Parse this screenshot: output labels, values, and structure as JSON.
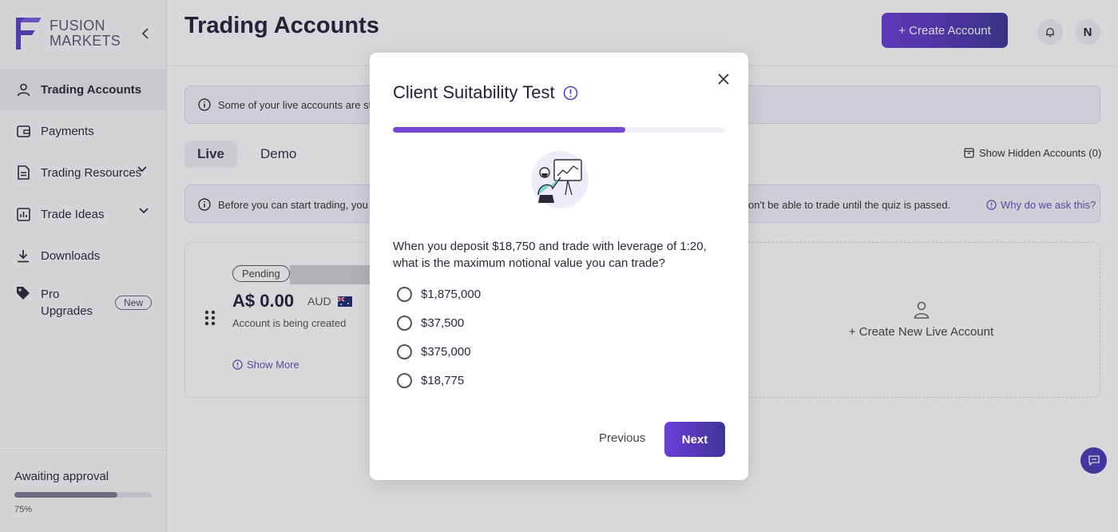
{
  "brand": {
    "line1": "FUSION",
    "line2": "MARKETS",
    "accent": "#6b3ed8"
  },
  "sidebar": {
    "items": [
      {
        "label": "Trading Accounts",
        "icon": "user-icon",
        "active": true
      },
      {
        "label": "Payments",
        "icon": "wallet-icon"
      },
      {
        "label": "Trading Resources",
        "icon": "document-icon"
      },
      {
        "label": "Trade Ideas",
        "icon": "chart-icon"
      },
      {
        "label": "Downloads",
        "icon": "download-icon"
      },
      {
        "label_line1": "Pro",
        "label_line2": "Upgrades",
        "icon": "tag-icon",
        "badge": "New"
      }
    ],
    "awaiting": {
      "label": "Awaiting approval",
      "progress_pct": 75,
      "progress_text": "75%"
    }
  },
  "header": {
    "title": "Trading Accounts",
    "create_label": "+ Create Account",
    "avatar_initial": "N"
  },
  "info_banner": {
    "text": "Some of your live accounts are still"
  },
  "tabs": [
    {
      "label": "Live",
      "active": true
    },
    {
      "label": "Demo"
    }
  ],
  "hidden_accounts_label": "Show Hidden Accounts (0)",
  "warn_banner": {
    "left_text": "Before you can start trading, you n",
    "right_text": "on't be able to trade until the quiz is passed.",
    "why_link": "Why do we ask this?"
  },
  "account": {
    "status_badge": "Pending",
    "balance": "A$ 0.00",
    "currency": "AUD",
    "status_text": "Account is being created",
    "show_more": "Show More"
  },
  "new_account": {
    "label": "+ Create New Live Account"
  },
  "modal": {
    "title": "Client Suitability Test",
    "progress_pct": 70,
    "question": "When you deposit $18,750 and trade with leverage of 1:20, what is the maximum notional value you can trade?",
    "options": [
      "$1,875,000",
      "$37,500",
      "$375,000",
      "$18,775"
    ],
    "previous_label": "Previous",
    "next_label": "Next"
  }
}
